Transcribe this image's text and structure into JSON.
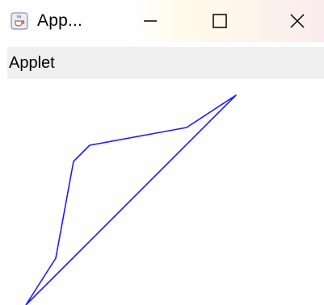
{
  "window": {
    "title": "App...",
    "minimize_glyph": "—",
    "maximize_glyph": "☐",
    "close_glyph": "✕",
    "icon": "java-coffee-cup-icon"
  },
  "menu": {
    "label": "Applet"
  },
  "drawing": {
    "stroke_color": "#1c1cff",
    "shape": "closed-polyline"
  }
}
